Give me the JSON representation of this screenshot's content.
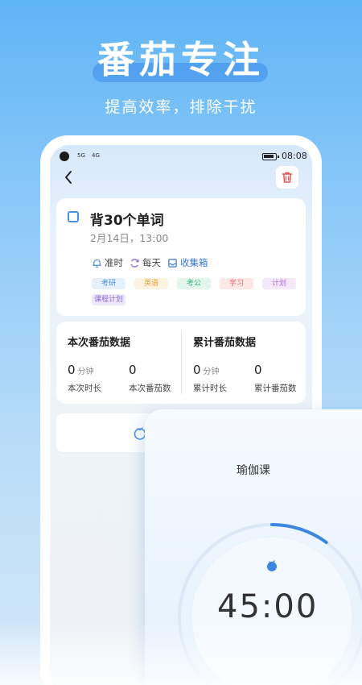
{
  "hero": {
    "title": "番茄专注",
    "subtitle": "提高效率，排除干扰"
  },
  "status_bar": {
    "signal_1": "5G",
    "signal_2": "4G",
    "time": "08:08"
  },
  "task": {
    "title": "背30个单词",
    "datetime": "2月14日，13:00",
    "reminder_label": "准时",
    "repeat_label": "每天",
    "list_label": "收集箱",
    "tags": [
      {
        "label": "考研",
        "color": "#4a90e2",
        "bg": "#e6f1fc"
      },
      {
        "label": "英语",
        "color": "#e0a23a",
        "bg": "#fdf2e0"
      },
      {
        "label": "考公",
        "color": "#3bb07a",
        "bg": "#e3f6ec"
      },
      {
        "label": "学习",
        "color": "#e26a6a",
        "bg": "#fde8e8"
      },
      {
        "label": "计划",
        "color": "#b46bd6",
        "bg": "#f5e8fb"
      },
      {
        "label": "课程计划",
        "color": "#8a6bd6",
        "bg": "#eee8fb"
      }
    ]
  },
  "stats": {
    "current": {
      "title": "本次番茄数据",
      "duration_value": "0",
      "duration_unit": "分钟",
      "duration_label": "本次时长",
      "count_value": "0",
      "count_label": "本次番茄数"
    },
    "total": {
      "title": "累计番茄数据",
      "duration_value": "0",
      "duration_unit": "分钟",
      "duration_label": "累计时长",
      "count_value": "0",
      "count_label": "累计番茄数"
    }
  },
  "timer": {
    "title": "瑜伽课",
    "display": "45:00",
    "progress": 0.1
  },
  "colors": {
    "accent": "#4a90e2",
    "trash": "#e05555"
  }
}
